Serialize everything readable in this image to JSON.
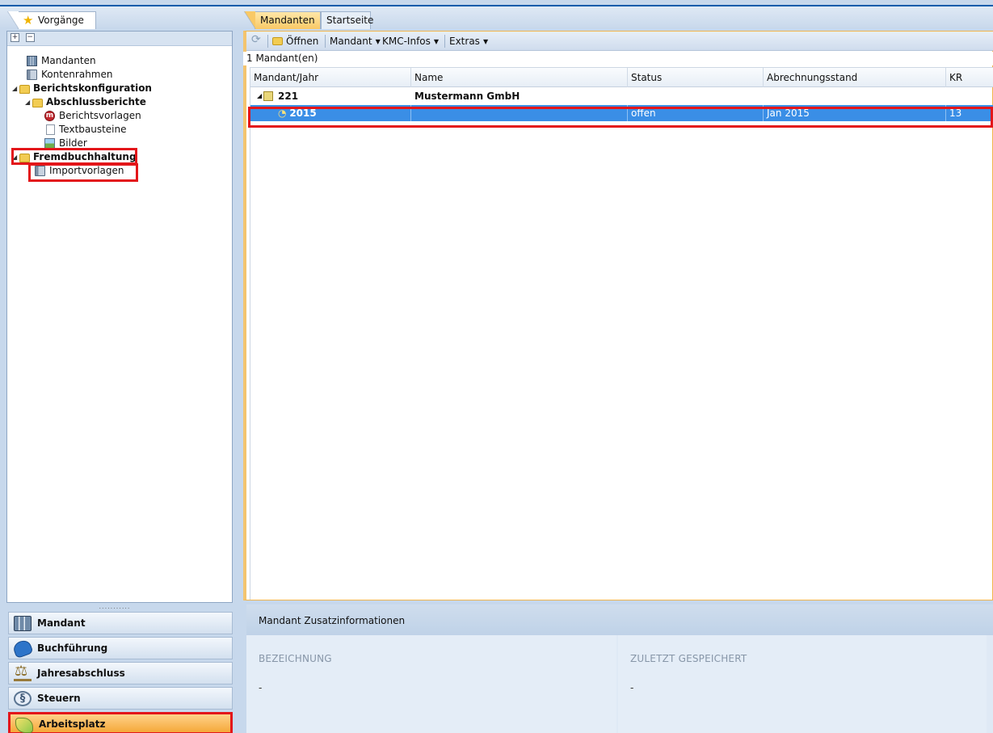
{
  "left": {
    "tab_label": "Vorgänge",
    "tree": [
      {
        "label": "Mandanten",
        "level": 1,
        "icon": "grid-icon",
        "bold": false
      },
      {
        "label": "Kontenrahmen",
        "level": 1,
        "icon": "book-icon",
        "bold": false
      },
      {
        "label": "Berichtskonfiguration",
        "level": 0,
        "icon": "folder-icon",
        "bold": true,
        "expanded": true
      },
      {
        "label": "Abschlussberichte",
        "level": 1,
        "icon": "folder-icon",
        "bold": true,
        "expanded": true
      },
      {
        "label": "Berichtsvorlagen",
        "level": 2,
        "icon": "report-icon",
        "bold": false
      },
      {
        "label": "Textbausteine",
        "level": 2,
        "icon": "document-icon",
        "bold": false
      },
      {
        "label": "Bilder",
        "level": 2,
        "icon": "image-icon",
        "bold": false
      },
      {
        "label": "Fremdbuchhaltung",
        "level": 0,
        "icon": "folder-icon",
        "bold": true,
        "expanded": true
      },
      {
        "label": "Importvorlagen",
        "level": 1,
        "icon": "book-icon",
        "bold": false
      }
    ],
    "nav": [
      {
        "label": "Mandant",
        "icon": "grid-icon",
        "active": false
      },
      {
        "label": "Buchführung",
        "icon": "book-icon",
        "active": false
      },
      {
        "label": "Jahresabschluss",
        "icon": "scale-icon",
        "active": false
      },
      {
        "label": "Steuern",
        "icon": "paragraph-icon",
        "active": false
      },
      {
        "label": "Arbeitsplatz",
        "icon": "workplace-icon",
        "active": true
      }
    ],
    "splitter": "..........."
  },
  "right": {
    "tabs": [
      "Mandanten",
      "Startseite"
    ],
    "toolbar": {
      "open": "Öffnen",
      "mandant": "Mandant",
      "kmc": "KMC-Infos",
      "extras": "Extras"
    },
    "count": "1 Mandant(en)",
    "columns": [
      "Mandant/Jahr",
      "Name",
      "Status",
      "Abrechnungsstand",
      "KR"
    ],
    "rows": [
      {
        "id": "221",
        "name": "Mustermann GmbH",
        "status": "",
        "stand": "",
        "kr": ""
      },
      {
        "id": "2015",
        "name": "",
        "status": "offen",
        "stand": "Jan 2015",
        "kr": "13"
      }
    ],
    "info": {
      "title": "Mandant Zusatzinformationen",
      "col1_label": "BEZEICHNUNG",
      "col1_value": "-",
      "col2_label": "ZULETZT GESPEICHERT",
      "col2_value": "-"
    }
  },
  "colors": {
    "highlight": "#e3161a",
    "selection": "#3a8ee6",
    "active_nav": "#f5a83a"
  }
}
